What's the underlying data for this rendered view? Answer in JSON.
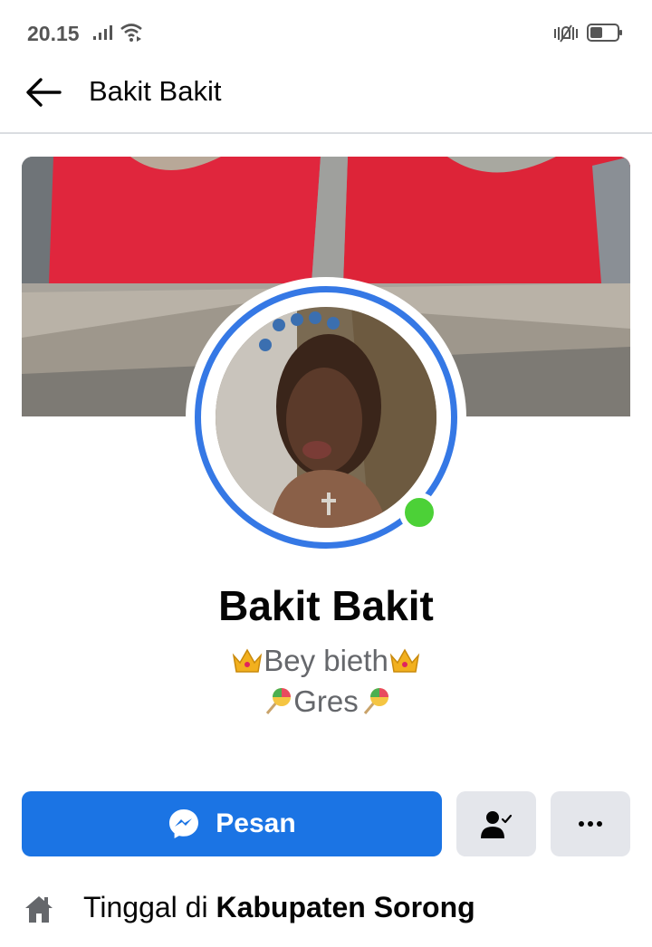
{
  "status_bar": {
    "time": "20.15",
    "icons": [
      "signal-icon",
      "wifi-icon",
      "vibrate-icon",
      "battery-icon"
    ]
  },
  "header": {
    "title": "Bakit Bakit",
    "back_icon": "back-arrow-icon"
  },
  "profile": {
    "name": "Bakit Bakit",
    "bio_line_1": "Bey bieth",
    "bio_line_2": "Gres",
    "online": true
  },
  "actions": {
    "message_label": "Pesan",
    "friend_icon": "friends-icon",
    "more_icon": "more-icon"
  },
  "intro": {
    "lives_prefix": "Tinggal di",
    "lives_place": "Kabupaten Sorong"
  },
  "colors": {
    "accent": "#1b74e4",
    "ring": "#3578e5",
    "online": "#4cd137",
    "secondary_button": "#e4e6eb",
    "muted_text": "#65676b"
  }
}
